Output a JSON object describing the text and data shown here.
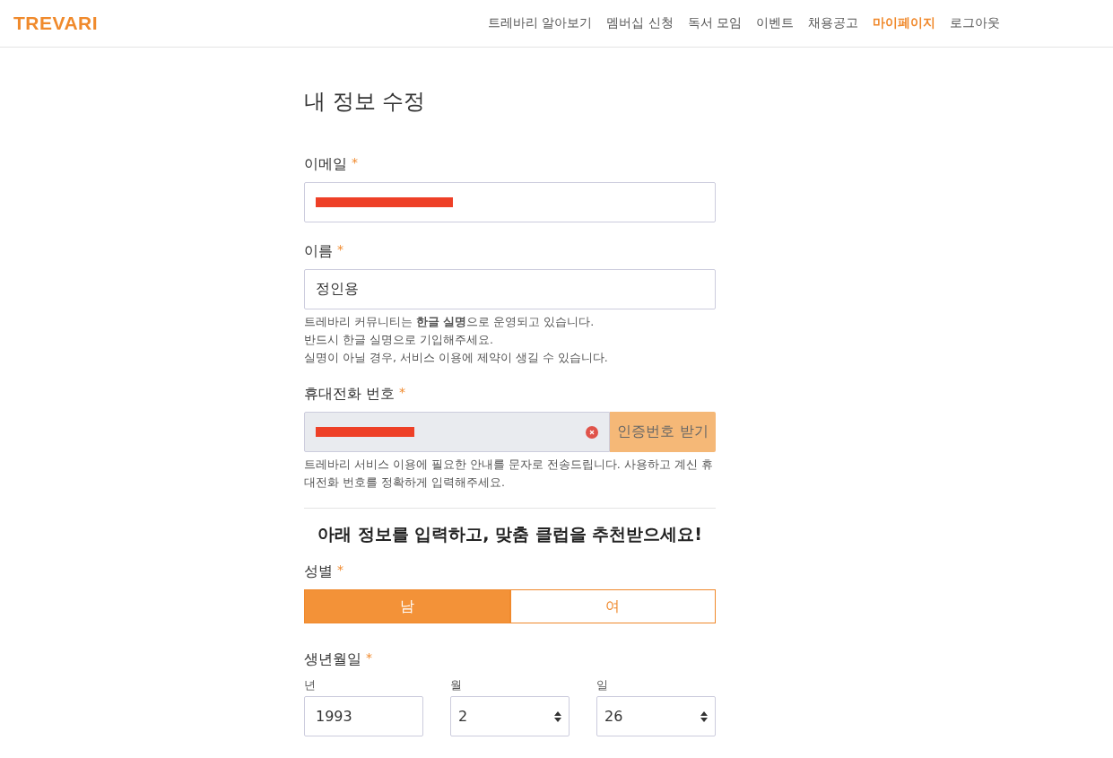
{
  "header": {
    "logo": "TREVARI",
    "nav": [
      {
        "label": "트레바리 알아보기",
        "selected": false
      },
      {
        "label": "멤버십 신청",
        "selected": false
      },
      {
        "label": "독서 모임",
        "selected": false
      },
      {
        "label": "이벤트",
        "selected": false
      },
      {
        "label": "채용공고",
        "selected": false
      },
      {
        "label": "마이페이지",
        "selected": true
      },
      {
        "label": "로그아웃",
        "selected": false
      }
    ]
  },
  "title": "내 정보 수정",
  "email": {
    "label": "이메일",
    "required_mark": "*",
    "redacted": true
  },
  "name": {
    "label": "이름",
    "required_mark": "*",
    "value": "정인용",
    "help": [
      "트레바리 커뮤니티는 **한글 실명**으로 운영되고 있습니다.",
      "반드시 한글 실명으로 기입해주세요.",
      "실명이 아닐 경우, 서비스 이용에 제약이 생길 수 있습니다."
    ]
  },
  "phone": {
    "label": "휴대전화 번호",
    "required_mark": "*",
    "redacted": true,
    "disabled": true,
    "button": "인증번호 받기",
    "help": "트레바리 서비스 이용에 필요한 안내를 문자로 전송드립니다. 사용하고 계신 휴대전화 번호를 정확하게 입력해주세요."
  },
  "recommend_heading": "아래 정보를 입력하고, 맞춤 클럽을 추천받으세요!",
  "gender": {
    "label": "성별",
    "required_mark": "*",
    "options": [
      {
        "label": "남",
        "selected": true
      },
      {
        "label": "여",
        "selected": false
      }
    ]
  },
  "birth": {
    "label": "생년월일",
    "required_mark": "*",
    "parts": [
      {
        "kind": "text",
        "label": "년",
        "value": "1993"
      },
      {
        "kind": "select",
        "label": "월",
        "value": "2"
      },
      {
        "kind": "select",
        "label": "일",
        "value": "26"
      }
    ]
  }
}
